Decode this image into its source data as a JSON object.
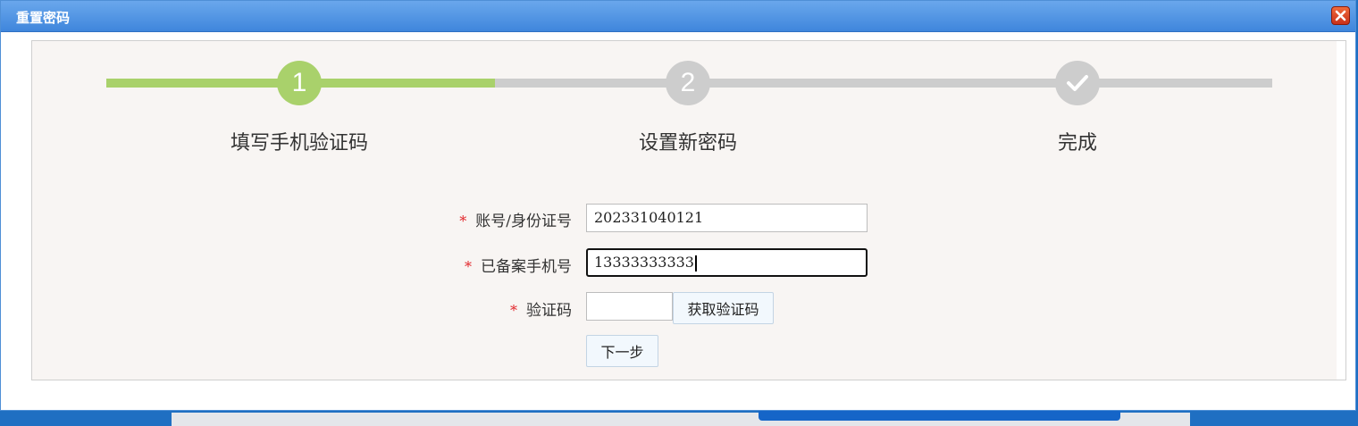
{
  "dialog": {
    "title": "重置密码",
    "close_icon": "close-icon",
    "accent_color": "#3f86dc"
  },
  "stepper": {
    "steps": [
      {
        "number": "1",
        "label": "填写手机验证码",
        "state": "active"
      },
      {
        "number": "2",
        "label": "设置新密码",
        "state": "pending"
      },
      {
        "icon": "checkmark-icon",
        "label": "完成",
        "state": "pending"
      }
    ],
    "active_color": "#a9d16b",
    "inactive_color": "#cdcdcd"
  },
  "form": {
    "required_mark": "*",
    "account": {
      "label": "账号/身份证号",
      "value": "202331040121"
    },
    "phone": {
      "label": "已备案手机号",
      "value": "13333333333"
    },
    "code": {
      "label": "验证码",
      "value": ""
    },
    "get_code_button": "获取验证码",
    "next_button": "下一步"
  }
}
